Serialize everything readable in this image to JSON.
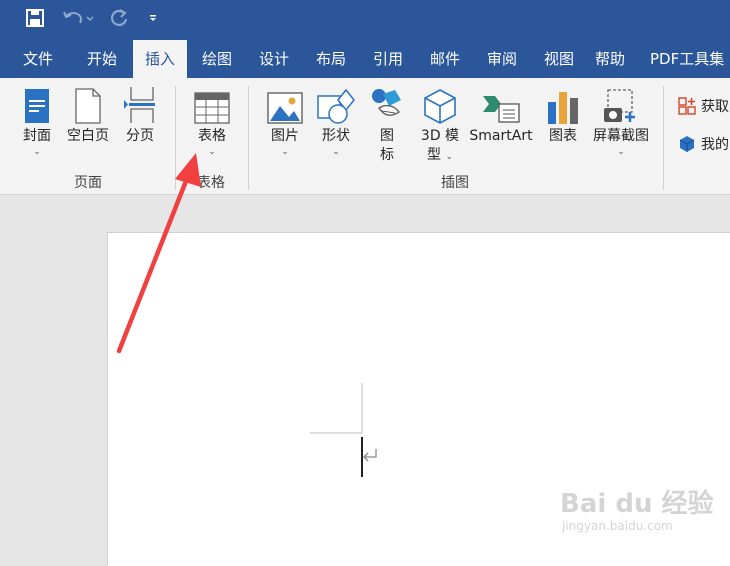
{
  "quick_access": {
    "save_icon": "save-icon",
    "undo_icon": "undo-icon",
    "redo_icon": "redo-icon",
    "customize_icon": "customize-qat-icon"
  },
  "tabs": [
    {
      "label": "文件"
    },
    {
      "label": "开始"
    },
    {
      "label": "插入",
      "active": true
    },
    {
      "label": "绘图"
    },
    {
      "label": "设计"
    },
    {
      "label": "布局"
    },
    {
      "label": "引用"
    },
    {
      "label": "邮件"
    },
    {
      "label": "审阅"
    },
    {
      "label": "视图"
    },
    {
      "label": "帮助"
    },
    {
      "label": "PDF工具集"
    }
  ],
  "ribbon": {
    "pages_group": {
      "label": "页面",
      "cover": "封面",
      "blank_page": "空白页",
      "page_break": "分页"
    },
    "table_group": {
      "label": "表格",
      "table": "表格"
    },
    "illustrations_group": {
      "label": "插图",
      "pictures": "图片",
      "shapes": "形状",
      "icons_line1": "图",
      "icons_line2": "标",
      "model3d_line1": "3D 模",
      "model3d_line2": "型",
      "smartart": "SmartArt",
      "chart": "图表",
      "screenshot": "屏幕截图"
    },
    "addins": {
      "get_addins": "获取",
      "my_addins": "我的"
    }
  },
  "watermark": {
    "brand": "Bai du 经验",
    "url": "jingyan.baidu.com"
  },
  "colors": {
    "title_bar": "#2b579a",
    "ribbon": "#f3f3f3",
    "arrow": "#f04040"
  }
}
